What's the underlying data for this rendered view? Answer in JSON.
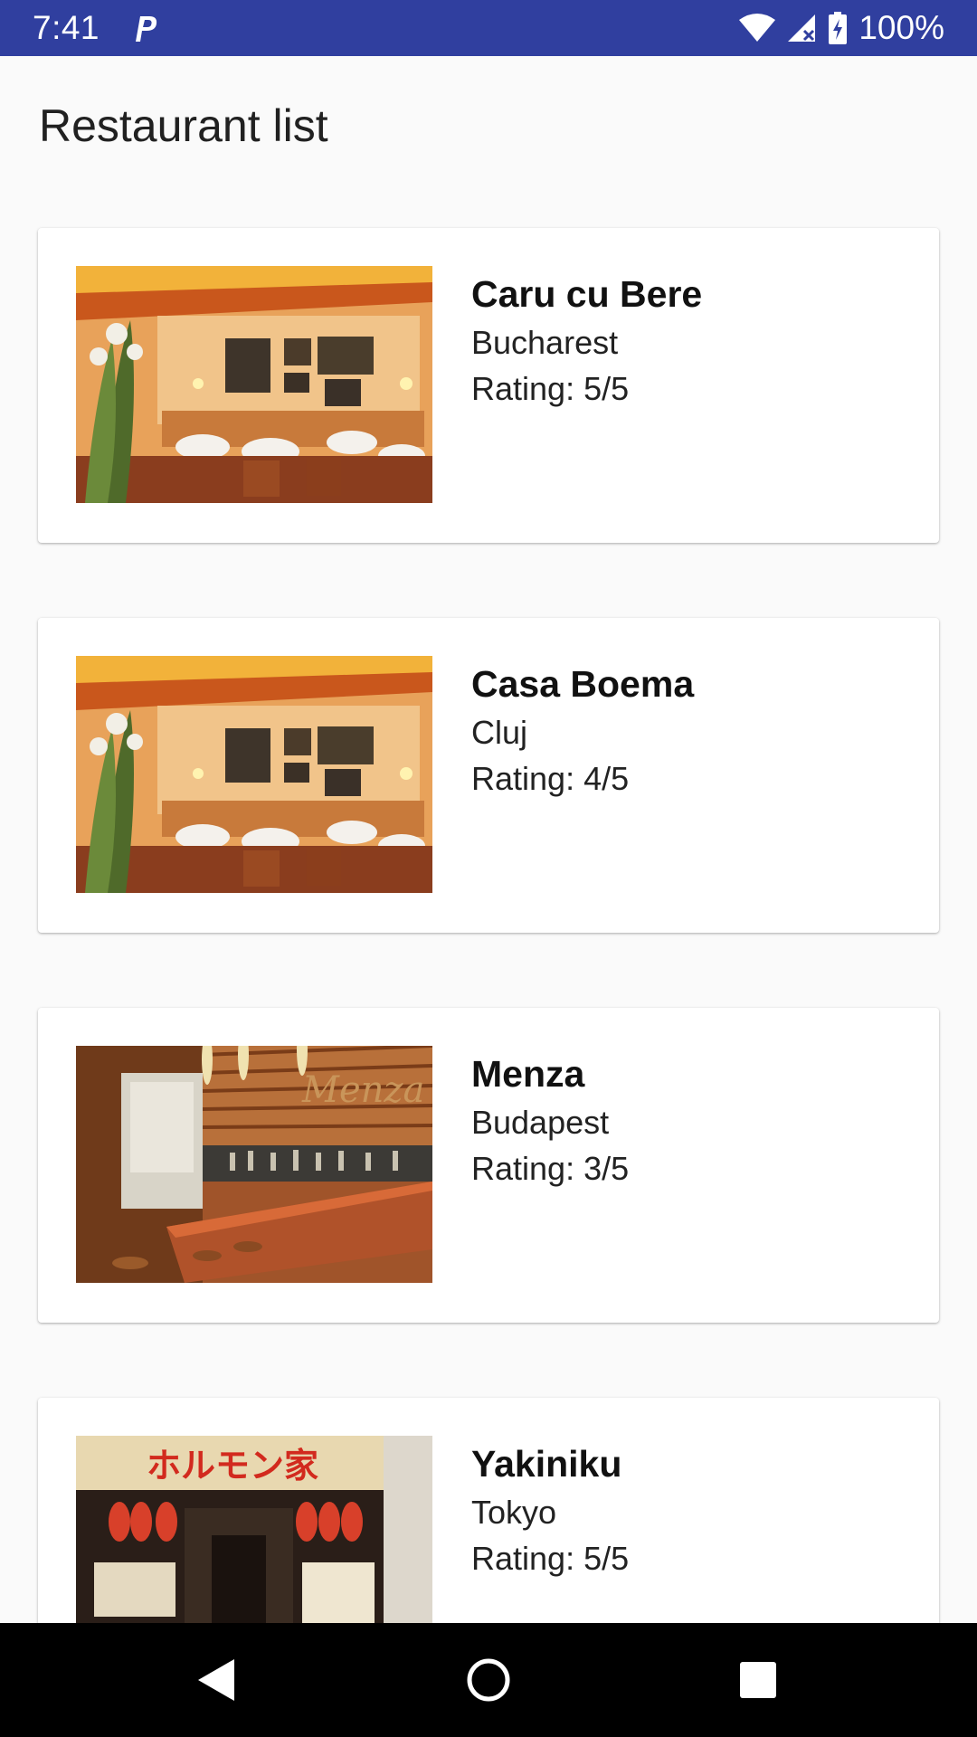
{
  "status_bar": {
    "time": "7:41",
    "notification_icon": "parking-p-icon",
    "battery": "100%",
    "bg_color": "#303f9f"
  },
  "page": {
    "title": "Restaurant list"
  },
  "restaurants": [
    {
      "name": "Caru cu Bere",
      "city": "Bucharest",
      "rating": "Rating: 5/5",
      "photo": "restaurant-dining-room-photo"
    },
    {
      "name": "Casa Boema",
      "city": "Cluj",
      "rating": "Rating: 4/5",
      "photo": "restaurant-dining-room-photo"
    },
    {
      "name": "Menza",
      "city": "Budapest",
      "rating": "Rating: 3/5",
      "photo": "restaurant-bar-counter-photo"
    },
    {
      "name": "Yakiniku",
      "city": "Tokyo",
      "rating": "Rating: 5/5",
      "photo": "japanese-storefront-photo"
    }
  ],
  "nav_bar": {
    "back_icon": "back-triangle-icon",
    "home_icon": "home-circle-icon",
    "recents_icon": "recents-square-icon"
  }
}
